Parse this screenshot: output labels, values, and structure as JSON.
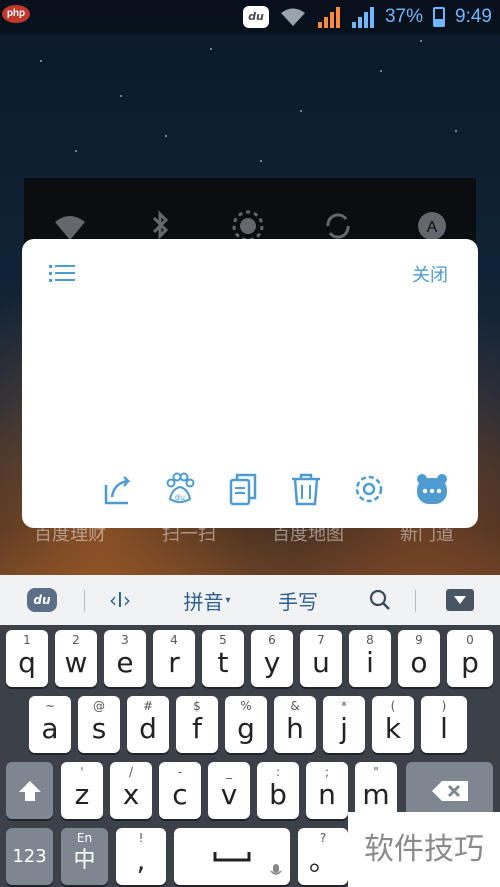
{
  "status_bar": {
    "site_logo": "php",
    "du_badge": "du",
    "battery_percent": "37%",
    "battery_level": 0.37,
    "time": "9:49"
  },
  "quick_settings": {
    "icons": [
      "wifi-icon",
      "bluetooth-icon",
      "brightness-icon",
      "sync-icon",
      "auto-rotate-icon"
    ]
  },
  "shortcut_labels": [
    "百度理财",
    "扫一扫",
    "百度地图",
    "新门道"
  ],
  "panel": {
    "close_label": "关闭",
    "toolbar_icons": [
      "share-icon",
      "baidu-paw-icon",
      "copy-icon",
      "trash-icon",
      "settings-icon",
      "more-icon"
    ]
  },
  "keyboard": {
    "toolbar": {
      "logo": "du",
      "cursor_label": "‹I›",
      "pinyin_label": "拼音",
      "handwriting_label": "手写",
      "search_icon": "search-icon",
      "hide_icon": "hide-keyboard-icon"
    },
    "row1": [
      {
        "main": "q",
        "sub": "1"
      },
      {
        "main": "w",
        "sub": "2"
      },
      {
        "main": "e",
        "sub": "3"
      },
      {
        "main": "r",
        "sub": "4"
      },
      {
        "main": "t",
        "sub": "5"
      },
      {
        "main": "y",
        "sub": "6"
      },
      {
        "main": "u",
        "sub": "7"
      },
      {
        "main": "i",
        "sub": "8"
      },
      {
        "main": "o",
        "sub": "9"
      },
      {
        "main": "p",
        "sub": "0"
      }
    ],
    "row2": [
      {
        "main": "a",
        "sub": "~"
      },
      {
        "main": "s",
        "sub": "@"
      },
      {
        "main": "d",
        "sub": "#"
      },
      {
        "main": "f",
        "sub": "$"
      },
      {
        "main": "g",
        "sub": "%"
      },
      {
        "main": "h",
        "sub": "&"
      },
      {
        "main": "j",
        "sub": "*"
      },
      {
        "main": "k",
        "sub": "("
      },
      {
        "main": "l",
        "sub": ")"
      }
    ],
    "row3": [
      {
        "main": "z",
        "sub": "'"
      },
      {
        "main": "x",
        "sub": "/"
      },
      {
        "main": "c",
        "sub": "-"
      },
      {
        "main": "v",
        "sub": "_"
      },
      {
        "main": "b",
        "sub": ":"
      },
      {
        "main": "n",
        "sub": ";"
      },
      {
        "main": "m",
        "sub": "\""
      }
    ],
    "row4": {
      "numbers_label": "123",
      "lang_sub": "En",
      "lang_main": "中",
      "comma_sub": "!",
      "comma_main": ",",
      "period_sub": "?",
      "period_main": "。"
    }
  },
  "watermark": "软件技巧"
}
